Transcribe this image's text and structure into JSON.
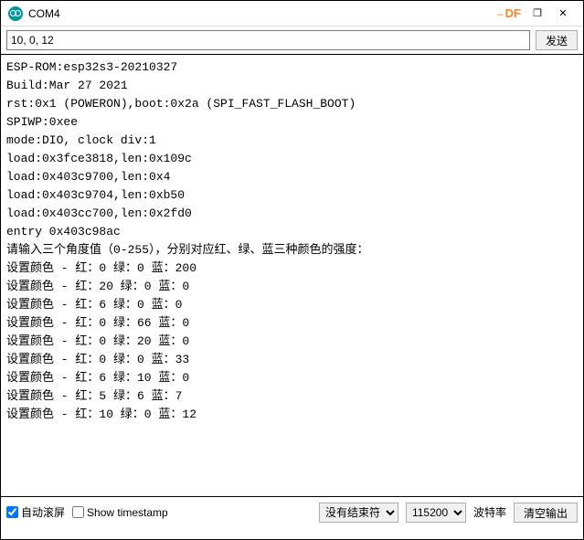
{
  "titlebar": {
    "icon": "arduino-icon",
    "title": "COM4",
    "dash": "–",
    "df": "DF",
    "restore": "❐",
    "close": "✕"
  },
  "inputRow": {
    "value": "10, 0, 12",
    "sendLabel": "发送"
  },
  "console": {
    "lines": [
      "ESP-ROM:esp32s3-20210327",
      "Build:Mar 27 2021",
      "rst:0x1 (POWERON),boot:0x2a (SPI_FAST_FLASH_BOOT)",
      "SPIWP:0xee",
      "mode:DIO, clock div:1",
      "load:0x3fce3818,len:0x109c",
      "load:0x403c9700,len:0x4",
      "load:0x403c9704,len:0xb50",
      "load:0x403cc700,len:0x2fd0",
      "entry 0x403c98ac",
      "请输入三个角度值（0-255），分别对应红、绿、蓝三种颜色的强度：",
      "设置颜色 - 红：0 绿：0 蓝：200",
      "设置颜色 - 红：20 绿：0 蓝：0",
      "设置颜色 - 红：6 绿：0 蓝：0",
      "设置颜色 - 红：0 绿：66 蓝：0",
      "设置颜色 - 红：0 绿：20 蓝：0",
      "设置颜色 - 红：0 绿：0 蓝：33",
      "设置颜色 - 红：6 绿：10 蓝：0",
      "设置颜色 - 红：5 绿：6 蓝：7",
      "设置颜色 - 红：10 绿：0 蓝：12"
    ]
  },
  "bottombar": {
    "autoscroll": "自动滚屏",
    "showts": "Show timestamp",
    "lineEnding": "没有结束符",
    "baud": "115200",
    "baudLabel": "波特率",
    "clear": "清空输出",
    "autoscrollChecked": true,
    "showtsChecked": false
  }
}
